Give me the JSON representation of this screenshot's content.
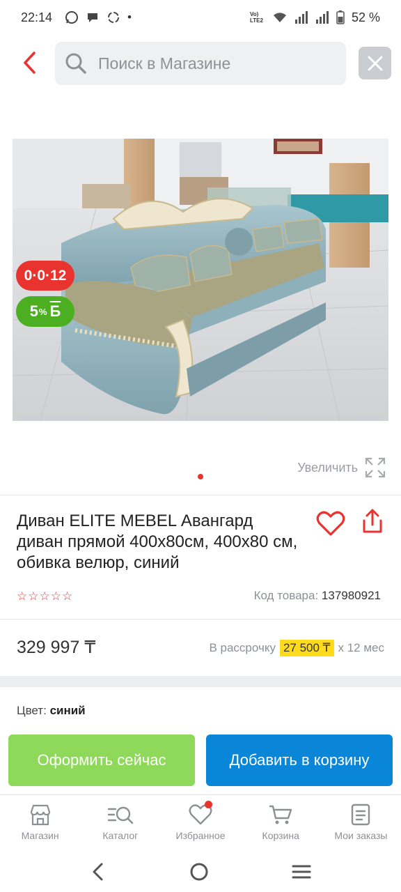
{
  "status_bar": {
    "time": "22:14",
    "notif_dot": "•",
    "network": "Vo) LTE2",
    "battery": "52 %"
  },
  "search": {
    "placeholder": "Поиск в Магазине"
  },
  "badges": {
    "installment": "0·0·12",
    "bonus_value": "5",
    "bonus_pct": "%",
    "bonus_letter": "Б"
  },
  "gallery": {
    "zoom_label": "Увеличить"
  },
  "product": {
    "title": "Диван ELITE MEBEL Авангард диван прямой 400x80см, 400x80 см, обивка велюр, синий",
    "rating_stars": 0,
    "code_label": "Код товара:",
    "code_value": "137980921",
    "price": "329 997 ₸",
    "installment_prefix": "В рассрочку",
    "installment_amount": "27 500 ₸",
    "installment_suffix": "x 12 мес",
    "color_label": "Цвет:",
    "color_value": "синий"
  },
  "actions": {
    "buy_now": "Оформить сейчас",
    "add_to_cart": "Добавить в корзину"
  },
  "bottom_nav": {
    "items": [
      {
        "label": "Магазин",
        "icon": "store-icon"
      },
      {
        "label": "Каталог",
        "icon": "catalog-search-icon"
      },
      {
        "label": "Избранное",
        "icon": "heart-icon"
      },
      {
        "label": "Корзина",
        "icon": "cart-icon"
      },
      {
        "label": "Мои заказы",
        "icon": "orders-icon"
      }
    ]
  },
  "colors": {
    "accent": "#e8332f",
    "buy_button": "#8ed85a",
    "cart_button": "#0a86d8",
    "bonus_badge": "#4caf22",
    "installment_highlight": "#ffdb1c"
  }
}
